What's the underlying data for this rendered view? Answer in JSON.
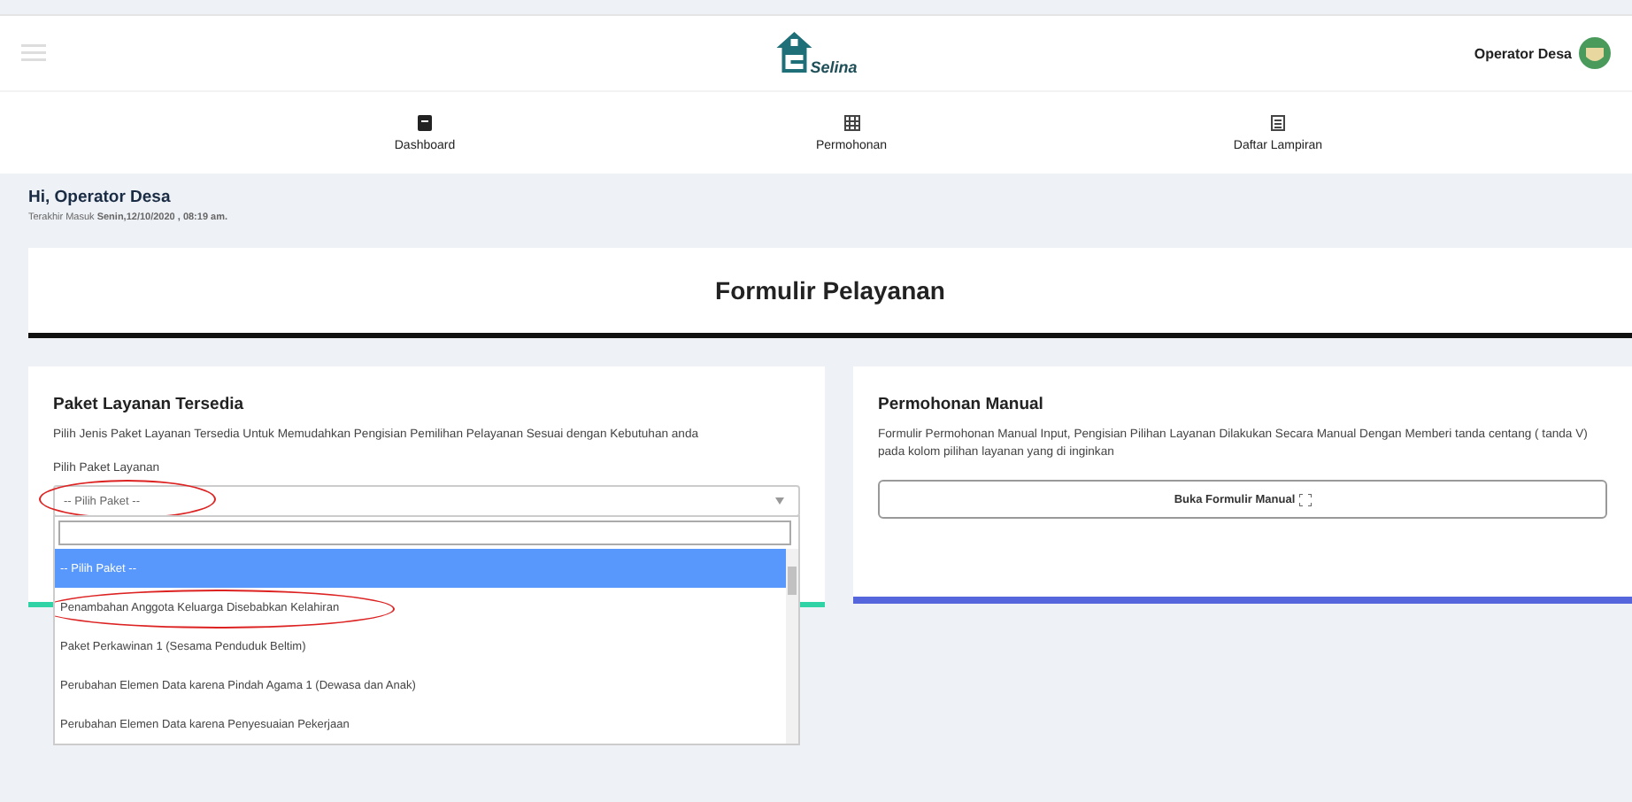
{
  "header": {
    "logo_text": "Selina",
    "user": "Operator Desa"
  },
  "nav": [
    {
      "label": "Dashboard",
      "kind": "note"
    },
    {
      "label": "Permohonan",
      "kind": "grid"
    },
    {
      "label": "Daftar Lampiran",
      "kind": "list"
    }
  ],
  "greeting": {
    "title": "Hi, Operator Desa",
    "last_login": "Terakhir Masuk **Senin,12/10/2020 , 08:19 am.**"
  },
  "page_title": "Formulir Pelayanan",
  "package_card": {
    "title": "Paket Layanan Tersedia",
    "description": "Pilih Jenis Paket Layanan Tersedia Untuk Memudahkan Pengisian Pemilihan Pelayanan Sesuai dengan Kebutuhan anda",
    "field_label": "Pilih Paket Layanan",
    "select": {
      "value": "-- Pilih Paket --",
      "circled": true
    },
    "options": [
      {
        "label": "-- Pilih Paket --",
        "selected": true,
        "circled": false
      },
      {
        "label": "Penambahan Anggota Keluarga Disebabkan Kelahiran",
        "selected": false,
        "circled": true
      },
      {
        "label": "Paket Perkawinan 1 (Sesama Penduduk Beltim)",
        "selected": false,
        "circled": false
      },
      {
        "label": "Perubahan Elemen Data karena Pindah Agama 1 (Dewasa dan Anak)",
        "selected": false,
        "circled": false
      },
      {
        "label": "Perubahan Elemen Data karena Penyesuaian Pekerjaan",
        "selected": false,
        "circled": false
      }
    ]
  },
  "manual_card": {
    "title": "Permohonan Manual",
    "description": "Formulir Permohonan Manual Input, Pengisian Pilihan Layanan Dilakukan Secara Manual Dengan Memberi tanda centang ( tanda V) pada kolom pilihan layanan yang di inginkan",
    "button": "Buka Formulir Manual"
  }
}
